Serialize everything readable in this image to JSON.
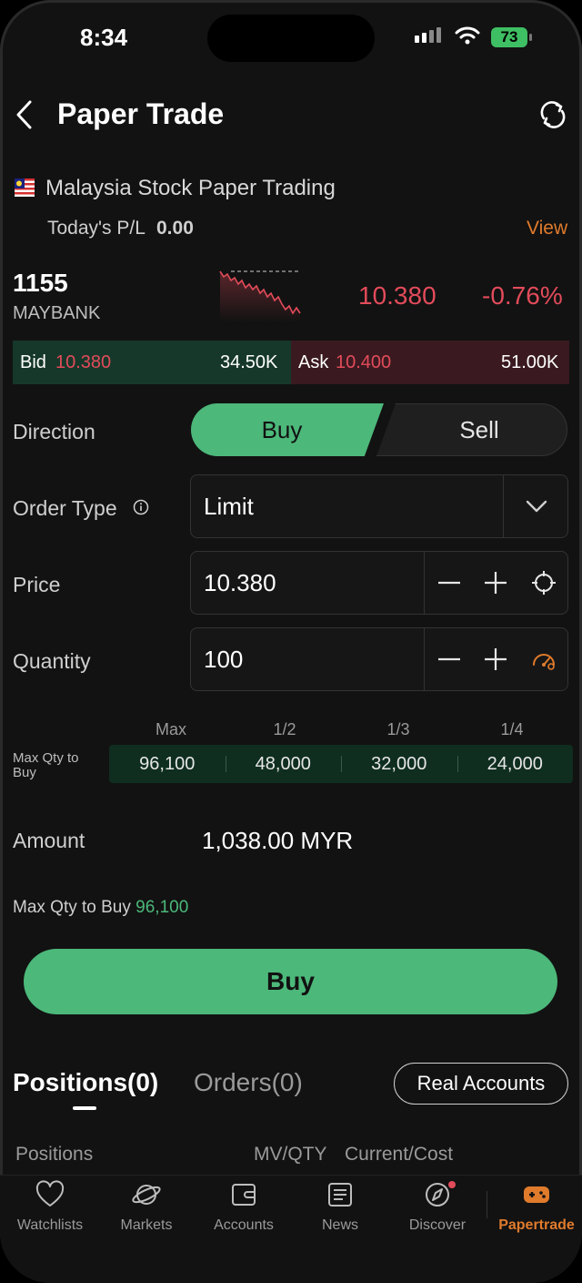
{
  "status": {
    "time": "8:34",
    "battery": "73"
  },
  "header": {
    "title": "Paper Trade"
  },
  "market": {
    "name": "Malaysia Stock Paper Trading",
    "pl_label": "Today's P/L",
    "pl_value": "0.00",
    "view_label": "View"
  },
  "stock": {
    "code": "1155",
    "name": "MAYBANK",
    "price": "10.380",
    "change": "-0.76%"
  },
  "quote": {
    "bid_label": "Bid",
    "bid_price": "10.380",
    "bid_size": "34.50K",
    "ask_label": "Ask",
    "ask_price": "10.400",
    "ask_size": "51.00K"
  },
  "form": {
    "direction_label": "Direction",
    "buy_label": "Buy",
    "sell_label": "Sell",
    "order_type_label": "Order Type",
    "order_type_value": "Limit",
    "price_label": "Price",
    "price_value": "10.380",
    "quantity_label": "Quantity",
    "quantity_value": "100"
  },
  "maxqty": {
    "side_label": "Max Qty to Buy",
    "headers": [
      "Max",
      "1/2",
      "1/3",
      "1/4"
    ],
    "values": [
      "96,100",
      "48,000",
      "32,000",
      "24,000"
    ]
  },
  "amount": {
    "label": "Amount",
    "value": "1,038.00 MYR"
  },
  "maxqty_line": {
    "label": "Max Qty to Buy",
    "value": "96,100"
  },
  "buy_button": "Buy",
  "tabs": {
    "positions": "Positions(0)",
    "orders": "Orders(0)",
    "real_accounts": "Real Accounts"
  },
  "columns": {
    "positions": "Positions",
    "mvqty": "MV/QTY",
    "current_cost": "Current/Cost"
  },
  "nav": [
    {
      "label": "Watchlists",
      "icon": "heart-icon"
    },
    {
      "label": "Markets",
      "icon": "planet-icon"
    },
    {
      "label": "Accounts",
      "icon": "wallet-icon"
    },
    {
      "label": "News",
      "icon": "news-icon"
    },
    {
      "label": "Discover",
      "icon": "compass-icon"
    },
    {
      "label": "Papertrade",
      "icon": "gamepad-icon"
    }
  ],
  "colors": {
    "accent_green": "#4cb87a",
    "down_red": "#e24b5a",
    "orange": "#e07b2c"
  }
}
